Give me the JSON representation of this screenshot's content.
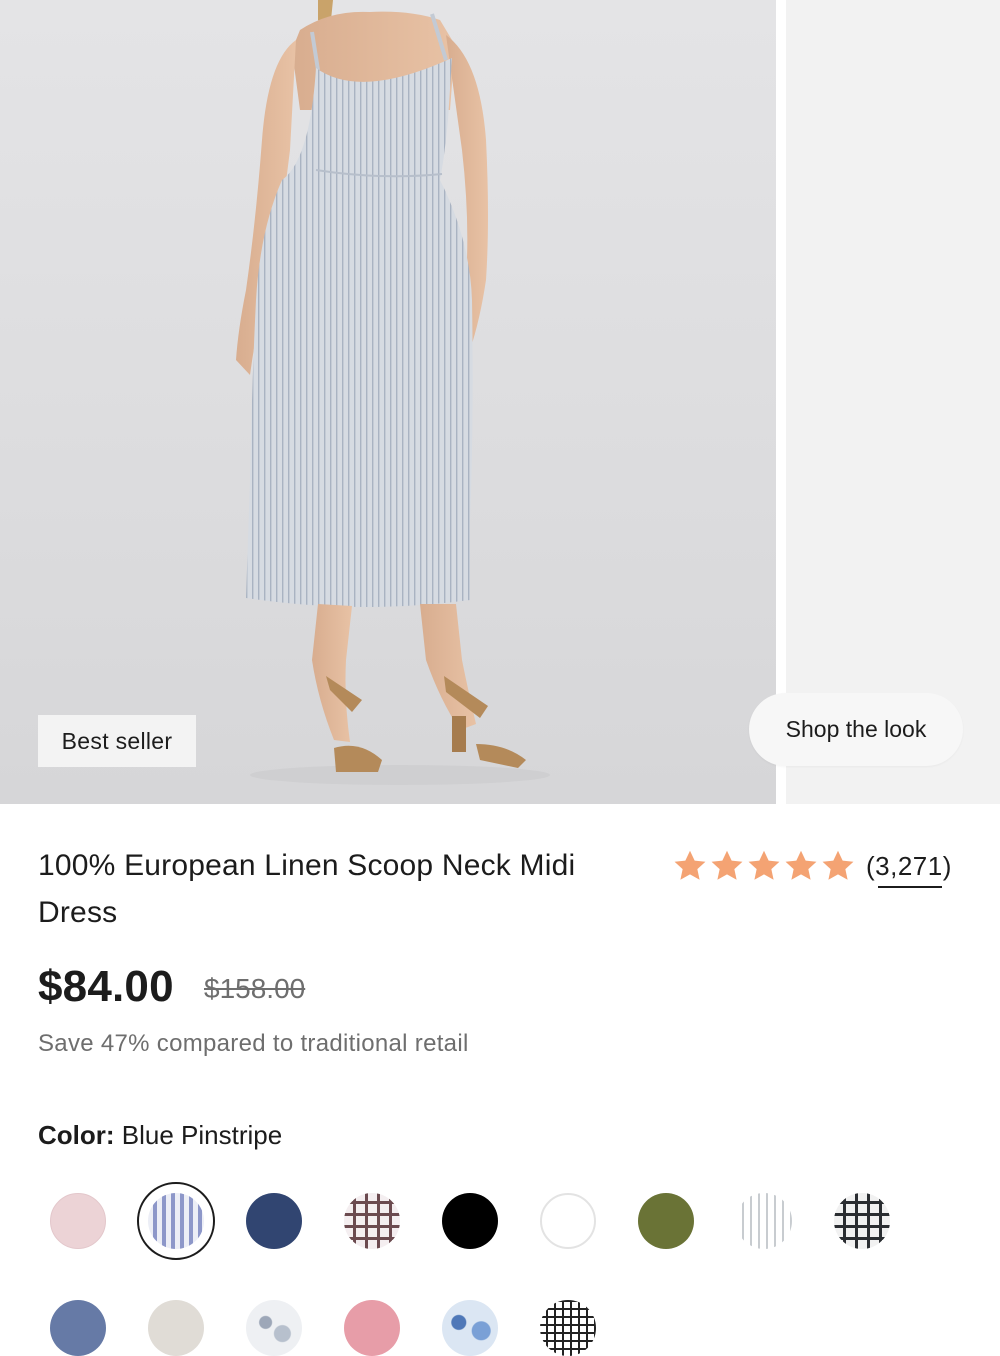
{
  "gallery": {
    "badge": "Best seller",
    "shop_the_look": "Shop the look"
  },
  "product": {
    "title": "100% European Linen Scoop Neck Midi Dress",
    "rating": 5,
    "review_count": "(3,271)",
    "price": "$84.00",
    "compare_price": "$158.00",
    "savings_note": "Save 47% compared to traditional retail",
    "color_label": "Color:",
    "color_value": "Blue Pinstripe"
  },
  "colors": {
    "star": "#f4a373",
    "swatches_row1": [
      "blush",
      "blue-pinstripe",
      "navy",
      "red-gingham",
      "black",
      "white",
      "olive",
      "grey-stripe",
      "black-gingham"
    ],
    "swatches_row2": [
      "slate-blue",
      "light-grey",
      "grey-floral",
      "pink",
      "blue-floral",
      "black-grid"
    ]
  }
}
